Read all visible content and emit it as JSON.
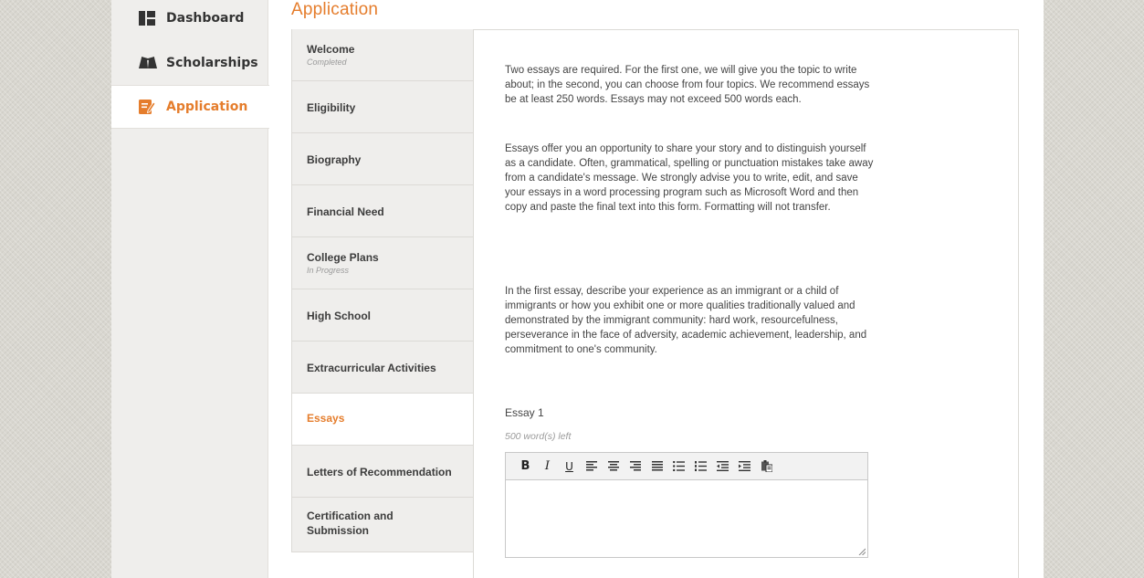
{
  "nav": {
    "items": [
      {
        "label": "Dashboard",
        "icon": "dashboard-icon",
        "active": false
      },
      {
        "label": "Scholarships",
        "icon": "books-icon",
        "active": false
      },
      {
        "label": "Application",
        "icon": "edit-icon",
        "active": true
      }
    ]
  },
  "page": {
    "title": "Application"
  },
  "steps": [
    {
      "label": "Welcome",
      "status": "Completed"
    },
    {
      "label": "Eligibility",
      "status": ""
    },
    {
      "label": "Biography",
      "status": ""
    },
    {
      "label": "Financial Need",
      "status": ""
    },
    {
      "label": "College Plans",
      "status": "In Progress"
    },
    {
      "label": "High School",
      "status": ""
    },
    {
      "label": "Extracurricular Activities",
      "status": ""
    },
    {
      "label": "Essays",
      "status": "",
      "active": true
    },
    {
      "label": "Letters of Recommendation",
      "status": ""
    },
    {
      "label": "Certification and Submission",
      "status": ""
    }
  ],
  "content": {
    "p1": "Two essays are required. For the first one, we will give you the topic to write about; in the second, you can choose from four topics. We recommend essays be at least 250 words.  Essays may not exceed 500 words each.",
    "p2": "Essays offer you an opportunity to share your story and to distinguish yourself as a candidate. Often, grammatical, spelling or punctuation mistakes take away from a candidate's message. We strongly advise you to write, edit, and save your essays in a word processing program such as Microsoft Word and then copy and paste the final text into this form. Formatting will not transfer.",
    "p3": "In the first essay, describe your experience as an immigrant or a child of immigrants or how you exhibit one or more qualities traditionally valued and demonstrated by the immigrant community: hard work, resourcefulness, perseverance in the face of adversity, academic achievement, leadership, and commitment to one's community.",
    "essay_label": "Essay 1",
    "words_left": "500 word(s) left",
    "essay_value": ""
  },
  "toolbar": {
    "bold": "B",
    "italic": "I",
    "underline": "U",
    "icons": [
      "align-left-icon",
      "align-center-icon",
      "align-right-icon",
      "justify-icon",
      "bullet-list-icon",
      "numbered-list-icon",
      "outdent-icon",
      "indent-icon",
      "paste-word-icon"
    ]
  },
  "colors": {
    "accent": "#e57d2c",
    "nav_bg": "#efeeec",
    "text": "#444444"
  }
}
